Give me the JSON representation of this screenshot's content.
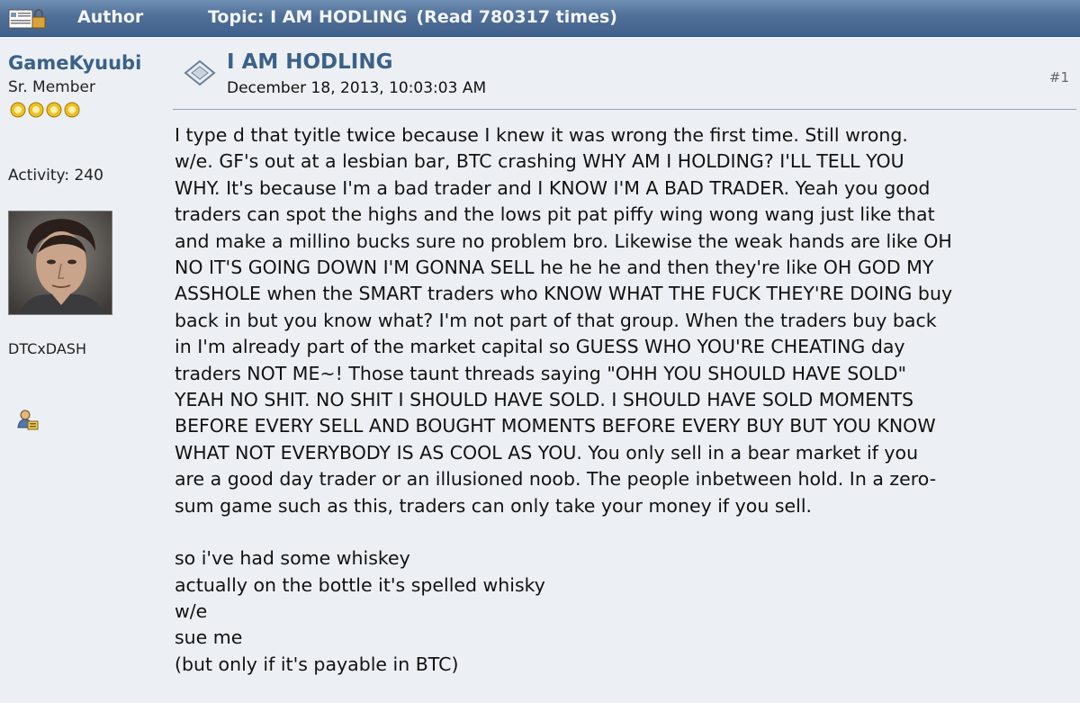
{
  "header": {
    "author_label": "Author",
    "topic_label": "Topic: I AM HODLING",
    "read_count": "(Read 780317 times)"
  },
  "poster": {
    "name": "GameKyuubi",
    "rank": "Sr. Member",
    "star_count": 4,
    "activity": "Activity: 240",
    "tagline": "DTCxDASH",
    "star_color": "#f0c020",
    "name_color": "#3b6189"
  },
  "post": {
    "subject": "I AM HODLING",
    "date": "December 18, 2013, 10:03:03 AM",
    "number": "#1",
    "lines": [
      "I type d that tyitle twice because I knew it was wrong the first time.  Still wrong.",
      "w/e.  GF's out at a lesbian bar, BTC crashing WHY AM I HOLDING? I'LL TELL YOU",
      "WHY.  It's because I'm a bad trader and I KNOW I'M A BAD TRADER.  Yeah you good",
      "traders can spot the highs and the lows pit pat piffy wing wong wang just like that",
      "and make a millino bucks sure no problem bro.  Likewise the weak hands are like OH",
      "NO IT'S GOING DOWN I'M GONNA SELL he he he and then they're like OH GOD MY",
      "ASSHOLE when the SMART traders who KNOW WHAT THE FUCK THEY'RE DOING buy",
      "back in but you know what?  I'm not part of that group.  When the traders buy back",
      "in I'm already part of the market capital so GUESS WHO YOU'RE CHEATING day",
      "traders NOT ME~!  Those taunt threads saying \"OHH YOU SHOULD HAVE SOLD\"",
      "YEAH NO SHIT.  NO SHIT I SHOULD HAVE SOLD.  I SHOULD HAVE SOLD MOMENTS",
      "BEFORE EVERY SELL AND BOUGHT MOMENTS BEFORE EVERY BUY BUT YOU KNOW",
      "WHAT NOT EVERYBODY IS AS COOL AS YOU.  You only sell in a bear market if you",
      "are a good day trader or an illusioned noob.  The people inbetween hold.  In a zero-",
      "sum game such as this, traders can only take your money if you sell."
    ],
    "lines2": [
      "so i've had some whiskey",
      "actually on the bottle it's spelled whisky",
      "w/e",
      "sue me",
      "(but only if it's payable in BTC)"
    ]
  },
  "icons": {
    "topic": "topic-icon",
    "post": "post-icon",
    "profile": "profile-icon",
    "star": "star-icon"
  }
}
